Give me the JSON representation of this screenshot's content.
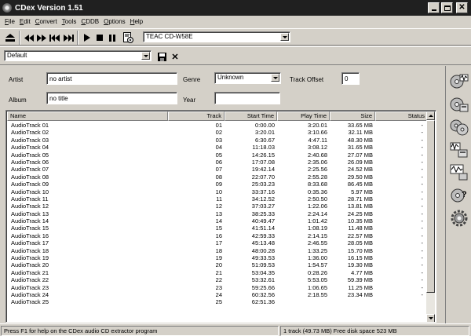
{
  "window": {
    "title": "CDex Version 1.51"
  },
  "menu": [
    {
      "key": "F",
      "rest": "ile"
    },
    {
      "key": "E",
      "rest": "dit"
    },
    {
      "key": "C",
      "rest": "onvert"
    },
    {
      "key": "T",
      "rest": "ools"
    },
    {
      "key": "C",
      "rest": "DDB"
    },
    {
      "key": "O",
      "rest": "ptions"
    },
    {
      "key": "H",
      "rest": "elp"
    }
  ],
  "toolbar": {
    "drive_value": "TEAC    CD-W58E"
  },
  "profile": {
    "value": "Default"
  },
  "fields": {
    "artist_label": "Artist",
    "artist_value": "no artist",
    "album_label": "Album",
    "album_value": "no title",
    "genre_label": "Genre",
    "genre_value": "Unknown",
    "year_label": "Year",
    "year_value": "",
    "offset_label": "Track Offset",
    "offset_value": "0"
  },
  "columns": [
    "Name",
    "Track",
    "Start Time",
    "Play Time",
    "Size",
    "Status"
  ],
  "tracks": [
    [
      "AudioTrack 01",
      "01",
      "0:00.00",
      "3:20.01",
      "33.65 MB",
      "-"
    ],
    [
      "AudioTrack 02",
      "02",
      "3:20.01",
      "3:10.66",
      "32.11 MB",
      "-"
    ],
    [
      "AudioTrack 03",
      "03",
      "6:30.67",
      "4:47.11",
      "48.30 MB",
      "-"
    ],
    [
      "AudioTrack 04",
      "04",
      "11:18.03",
      "3:08.12",
      "31.65 MB",
      "-"
    ],
    [
      "AudioTrack 05",
      "05",
      "14:26.15",
      "2:40.68",
      "27.07 MB",
      "-"
    ],
    [
      "AudioTrack 06",
      "06",
      "17:07.08",
      "2:35.06",
      "26.09 MB",
      "-"
    ],
    [
      "AudioTrack 07",
      "07",
      "19:42.14",
      "2:25.56",
      "24.52 MB",
      "-"
    ],
    [
      "AudioTrack 08",
      "08",
      "22:07.70",
      "2:55.28",
      "29.50 MB",
      "-"
    ],
    [
      "AudioTrack 09",
      "09",
      "25:03.23",
      "8:33.68",
      "86.45 MB",
      "-"
    ],
    [
      "AudioTrack 10",
      "10",
      "33:37.16",
      "0:35.36",
      "5.97 MB",
      "-"
    ],
    [
      "AudioTrack 11",
      "11",
      "34:12.52",
      "2:50.50",
      "28.71 MB",
      "-"
    ],
    [
      "AudioTrack 12",
      "12",
      "37:03.27",
      "1:22.06",
      "13.81 MB",
      "-"
    ],
    [
      "AudioTrack 13",
      "13",
      "38:25.33",
      "2:24.14",
      "24.25 MB",
      "-"
    ],
    [
      "AudioTrack 14",
      "14",
      "40:49.47",
      "1:01.42",
      "10.35 MB",
      "-"
    ],
    [
      "AudioTrack 15",
      "15",
      "41:51.14",
      "1:08.19",
      "11.48 MB",
      "-"
    ],
    [
      "AudioTrack 16",
      "16",
      "42:59.33",
      "2:14.15",
      "22.57 MB",
      "-"
    ],
    [
      "AudioTrack 17",
      "17",
      "45:13.48",
      "2:46.55",
      "28.05 MB",
      "-"
    ],
    [
      "AudioTrack 18",
      "18",
      "48:00.28",
      "1:33.25",
      "15.70 MB",
      "-"
    ],
    [
      "AudioTrack 19",
      "19",
      "49:33.53",
      "1:36.00",
      "16.15 MB",
      "-"
    ],
    [
      "AudioTrack 20",
      "20",
      "51:09.53",
      "1:54.57",
      "19.30 MB",
      "-"
    ],
    [
      "AudioTrack 21",
      "21",
      "53:04.35",
      "0:28.26",
      "4.77 MB",
      "-"
    ],
    [
      "AudioTrack 22",
      "22",
      "53:32.61",
      "5:53.05",
      "59.39 MB",
      "-"
    ],
    [
      "AudioTrack 23",
      "23",
      "59:25.66",
      "1:06.65",
      "11.25 MB",
      "-"
    ],
    [
      "AudioTrack 24",
      "24",
      "60:32.56",
      "2:18.55",
      "23.34 MB",
      "-"
    ],
    [
      "AudioTrack 25",
      "25",
      "62:51.36",
      "",
      "",
      ""
    ]
  ],
  "status": {
    "help": "Press F1 for help on the CDex audio CD extractor program",
    "info": "1 track (49.73 MB) Free disk space  523 MB"
  }
}
